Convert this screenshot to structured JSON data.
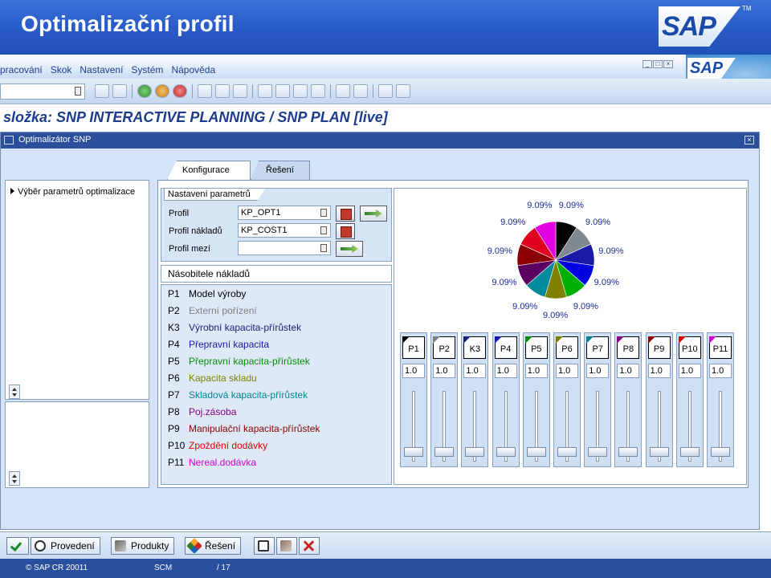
{
  "banner": {
    "title": "Optimalizační profil",
    "logo_text": "SAP",
    "tm": "TM"
  },
  "menubar": {
    "items": [
      "pracování",
      "Skok",
      "Nastavení",
      "Systém",
      "Nápověda"
    ],
    "logo_text": "SAP"
  },
  "transaction": {
    "title": "složka: SNP INTERACTIVE PLANNING / SNP PLAN [live]"
  },
  "window": {
    "title": "Optimalizátor SNP"
  },
  "tree": {
    "item": "Výběr parametrů optimalizace"
  },
  "tabs": [
    {
      "label": "Konfigurace",
      "active": true
    },
    {
      "label": "Řešení",
      "active": false
    }
  ],
  "params": {
    "group_title": "Nastavení parametrů",
    "rows": [
      {
        "label": "Profil",
        "value": "KP_OPT1"
      },
      {
        "label": "Profil nákladů",
        "value": "KP_COST1"
      },
      {
        "label": "Profil mezí",
        "value": ""
      }
    ]
  },
  "cost": {
    "heading": "Násobitele nákladů",
    "rows": [
      {
        "code": "P1",
        "text": "Model výroby",
        "color": "#000000"
      },
      {
        "code": "P2",
        "text": "Externí pořízení",
        "color": "#808080"
      },
      {
        "code": "K3",
        "text": "Výrobní kapacita-přírůstek",
        "color": "#1a237e"
      },
      {
        "code": "P4",
        "text": "Přepravní kapacita",
        "color": "#1a1aa8"
      },
      {
        "code": "P5",
        "text": "Přepravní kapacita-přírůstek",
        "color": "#0a8a0a"
      },
      {
        "code": "P6",
        "text": "Kapacita skladu",
        "color": "#808000"
      },
      {
        "code": "P7",
        "text": "Skladová kapacita-přírůstek",
        "color": "#00838f"
      },
      {
        "code": "P8",
        "text": "Poj.zásoba",
        "color": "#800080"
      },
      {
        "code": "P9",
        "text": "Manipulační kapacita-přírůstek",
        "color": "#8b0000"
      },
      {
        "code": "P10",
        "text": "Zpoždění dodávky",
        "color": "#e00000"
      },
      {
        "code": "P11",
        "text": "Nereal.dodávka",
        "color": "#d000d0"
      }
    ]
  },
  "chart_data": {
    "type": "pie",
    "categories": [
      "P1",
      "P2",
      "K3",
      "P4",
      "P5",
      "P6",
      "P7",
      "P8",
      "P9",
      "P10",
      "P11"
    ],
    "values": [
      9.09,
      9.09,
      9.09,
      9.09,
      9.09,
      9.09,
      9.09,
      9.09,
      9.09,
      9.09,
      9.09
    ],
    "labels": [
      "9.09%",
      "9.09%",
      "9.09%",
      "9.09%",
      "9.09%",
      "9.09%",
      "9.09%",
      "9.09%",
      "9.09%",
      "9.09%",
      "9.09%"
    ],
    "colors": [
      "#000000",
      "#808890",
      "#1a1aa8",
      "#0000e0",
      "#00b000",
      "#808000",
      "#008b9c",
      "#5a0060",
      "#8b0000",
      "#e00020",
      "#e000e0"
    ]
  },
  "sliders": [
    {
      "label": "P1",
      "value": "1.0",
      "level": 0,
      "color": "#000000"
    },
    {
      "label": "P2",
      "value": "1.0",
      "level": 0,
      "color": "#808080"
    },
    {
      "label": "K3",
      "value": "1.0",
      "level": 0,
      "color": "#1a237e"
    },
    {
      "label": "P4",
      "value": "1.0",
      "level": 0,
      "color": "#1a1aa8"
    },
    {
      "label": "P5",
      "value": "1.0",
      "level": 0,
      "color": "#0a8a0a"
    },
    {
      "label": "P6",
      "value": "1.0",
      "level": 0,
      "color": "#808000"
    },
    {
      "label": "P7",
      "value": "1.0",
      "level": 0,
      "color": "#00838f"
    },
    {
      "label": "P8",
      "value": "1.0",
      "level": 0,
      "color": "#800080"
    },
    {
      "label": "P9",
      "value": "1.0",
      "level": 0,
      "color": "#8b0000"
    },
    {
      "label": "P10",
      "value": "1.0",
      "level": 0,
      "color": "#e00000"
    },
    {
      "label": "P11",
      "value": "1.0",
      "level": 0,
      "color": "#d000d0"
    }
  ],
  "appbar": {
    "run_label": "Provedení",
    "products_label": "Produkty",
    "solution_label": "Řešení"
  },
  "footer": {
    "copyright": "© SAP CR 20011",
    "system": "SCM",
    "page": "/ 17"
  }
}
